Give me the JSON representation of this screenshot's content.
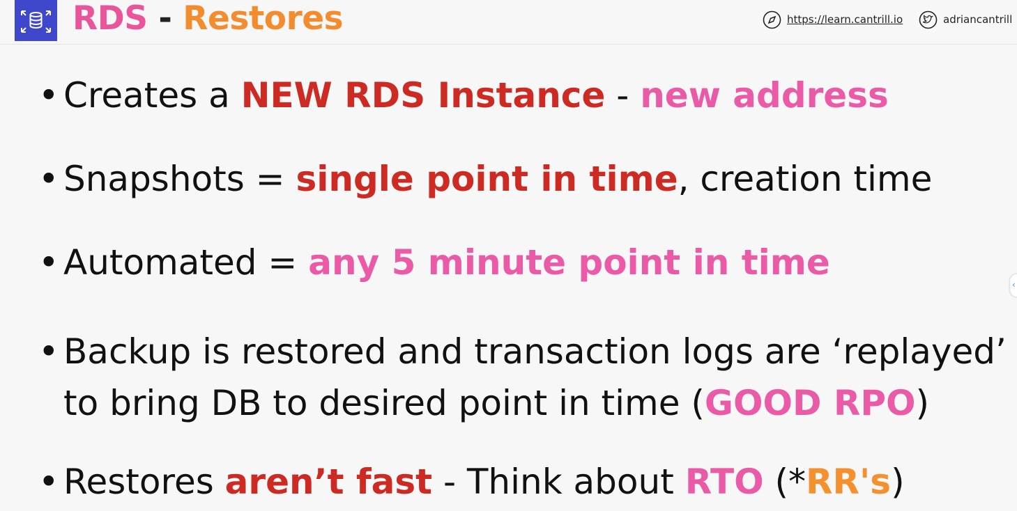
{
  "header": {
    "logo_icon": "rds-database-icon",
    "title_part1": "RDS",
    "title_sep": " - ",
    "title_part2": "Restores",
    "site_icon": "compass-icon",
    "site_link": "https://learn.cantrill.io",
    "twitter_icon": "twitter-bird-icon",
    "twitter_handle": "adriancantrill"
  },
  "colors": {
    "pink": "#ea5aa6",
    "red": "#cc2a22",
    "orange": "#f5902e",
    "logo_bg": "#3f48cc"
  },
  "bullets": [
    {
      "a": "Creates a ",
      "b": "NEW RDS Instance",
      "c": " - ",
      "d": "new address"
    },
    {
      "a": "Snapshots = ",
      "b": "single point in time",
      "c": ", creation time"
    },
    {
      "a": "Automated = ",
      "b": "any 5 minute point in time"
    },
    {
      "line1": "Backup is restored and transaction logs are ‘replayed’",
      "line2a": "to bring DB to desired point in time (",
      "line2b": "GOOD RPO",
      "line2c": ")"
    },
    {
      "a": "Restores ",
      "b": "aren’t fast",
      "c": " - Think about ",
      "d": "RTO",
      "e": " (*",
      "f": "RR's",
      "g": ")"
    }
  ]
}
